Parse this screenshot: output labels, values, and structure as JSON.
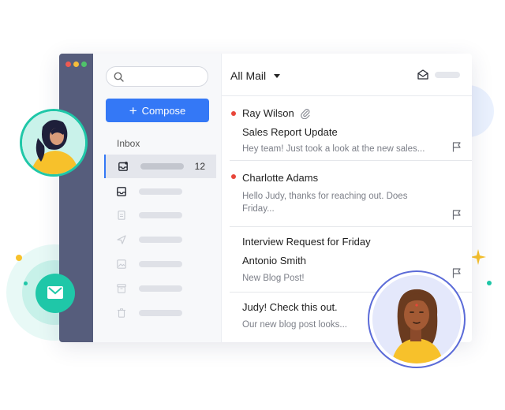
{
  "sidebar": {
    "search": {
      "placeholder": ""
    },
    "compose_label": "Compose",
    "section_label": "Inbox",
    "folders": [
      {
        "icon": "inbox-icon",
        "count": "12",
        "active": true
      },
      {
        "icon": "tray-icon"
      },
      {
        "icon": "document-icon"
      },
      {
        "icon": "send-icon"
      },
      {
        "icon": "image-icon"
      },
      {
        "icon": "archive-icon"
      },
      {
        "icon": "trash-icon"
      }
    ]
  },
  "header": {
    "title": "All Mail"
  },
  "mails": [
    {
      "sender": "Ray Wilson",
      "subject": "Sales Report Update",
      "preview": "Hey team! Just took a look at the new sales...",
      "unread": true,
      "attachment": true
    },
    {
      "sender": "Charlotte Adams",
      "preview_line1": "Hello Judy, thanks for reaching out. Does",
      "preview_line2": "Friday...",
      "unread": true
    },
    {
      "subject": "Interview Request for Friday",
      "sender": "Antonio Smith",
      "preview": "New Blog Post!"
    },
    {
      "subject": "Judy! Check this out.",
      "preview": "Our new blog post looks..."
    }
  ],
  "colors": {
    "accent": "#3478f6",
    "rail": "#565d7c",
    "unread": "#e8463a",
    "teal": "#1fc7a8",
    "gold": "#f7c12b"
  }
}
